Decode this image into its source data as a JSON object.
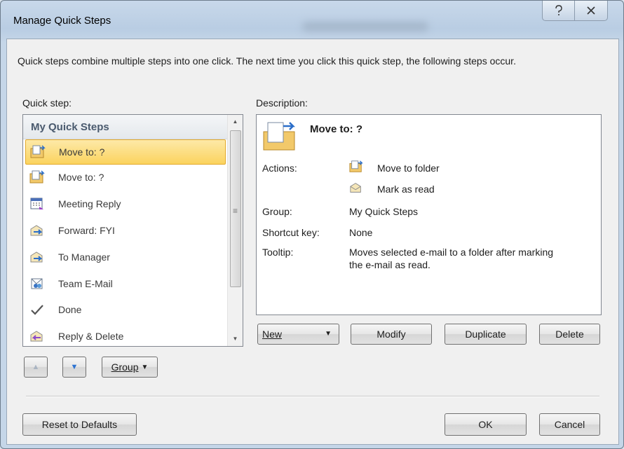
{
  "window": {
    "title": "Manage Quick Steps",
    "help_label": "?",
    "close_label": "✕"
  },
  "intro": "Quick steps combine multiple steps into one click. The next time you click this quick step, the following steps occur.",
  "quick_step_label": "Quick step:",
  "description_label": "Description:",
  "list": {
    "group": "My Quick Steps",
    "items": [
      {
        "label": "Move to: ?",
        "icon": "move-folder-icon",
        "selected": true
      },
      {
        "label": "Move to: ?",
        "icon": "move-folder-icon"
      },
      {
        "label": "Meeting Reply",
        "icon": "calendar-icon"
      },
      {
        "label": "Forward: FYI",
        "icon": "forward-mail-icon"
      },
      {
        "label": "To Manager",
        "icon": "forward-mail-icon"
      },
      {
        "label": "Team E-Mail",
        "icon": "team-mail-icon"
      },
      {
        "label": "Done",
        "icon": "checkmark-icon"
      },
      {
        "label": "Reply & Delete",
        "icon": "reply-delete-icon"
      }
    ]
  },
  "description": {
    "name": "Move to: ?",
    "actions_label": "Actions:",
    "actions": [
      "Move to folder",
      "Mark as read"
    ],
    "group_label": "Group:",
    "group_value": "My Quick Steps",
    "shortcut_label": "Shortcut key:",
    "shortcut_value": "None",
    "tooltip_label": "Tooltip:",
    "tooltip_line1": "Moves selected e-mail to a folder after marking",
    "tooltip_line2": "the e-mail as read."
  },
  "buttons": {
    "new": "New",
    "modify": "Modify",
    "duplicate": "Duplicate",
    "delete": "Delete",
    "group": "Group",
    "reset": "Reset to Defaults",
    "ok": "OK",
    "cancel": "Cancel"
  },
  "colors": {
    "selection": "#fbd35e",
    "selection_border": "#e3a92a",
    "group_header_text": "#4a5a6e"
  }
}
